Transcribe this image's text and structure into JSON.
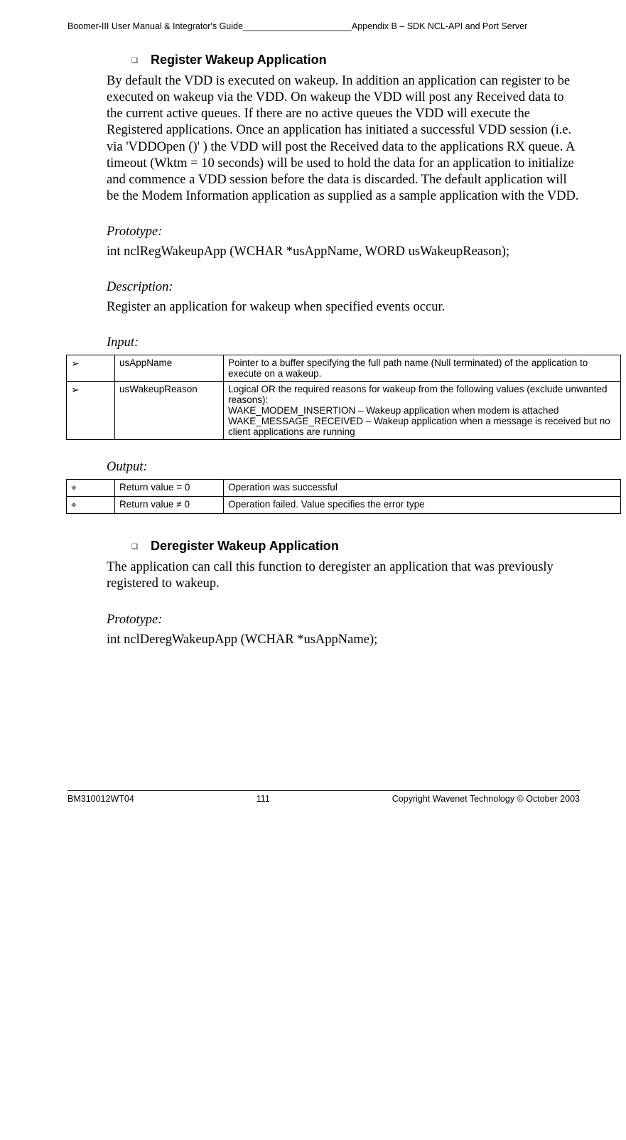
{
  "header": {
    "left": "Boomer-III User Manual & Integrator's Guide______________________Appendix B – SDK NCL-API and Port Server"
  },
  "section1": {
    "heading": "Register Wakeup Application",
    "body": "By default the VDD is executed on wakeup. In addition an application can register to be executed on wakeup via the VDD. On wakeup the VDD will post any Received data to the current active queues. If there are no active queues the VDD will execute the Registered applications. Once an application has initiated a successful VDD session (i.e. via 'VDDOpen ()' ) the VDD will post the Received data to the applications RX queue. A timeout (Wktm = 10 seconds) will be used to hold the data for an application to initialize and commence a VDD session before the data is discarded. The default application will be the Modem Information application as supplied as a sample application with the VDD.",
    "labels": {
      "prototype": "Prototype:",
      "description": "Description:",
      "input": "Input:",
      "output": "Output:"
    },
    "prototype_text": "int nclRegWakeupApp (WCHAR *usAppName, WORD usWakeupReason);",
    "description_text": "Register an application for wakeup when specified events occur.",
    "input_rows": [
      {
        "arrow": "➢",
        "name": "usAppName",
        "desc": "Pointer to a buffer specifying the full path name (Null terminated) of the application to execute on a wakeup."
      },
      {
        "arrow": "➢",
        "name": "usWakeupReason",
        "desc": "Logical OR the required reasons for wakeup from the following values (exclude unwanted reasons):\nWAKE_MODEM_INSERTION – Wakeup application when modem is attached\nWAKE_MESSAGE_RECEIVED – Wakeup application when a message is received but no client applications are running"
      }
    ],
    "output_rows": [
      {
        "arrow": "⌖",
        "name": "Return value = 0",
        "desc": "Operation was successful"
      },
      {
        "arrow": "⌖",
        "name": "Return value  ≠ 0",
        "desc": "Operation failed. Value specifies the error type"
      }
    ]
  },
  "section2": {
    "heading": "Deregister Wakeup Application",
    "body": "The application can call this function to deregister an application that was previously registered to wakeup.",
    "labels": {
      "prototype": "Prototype:"
    },
    "prototype_text": "int nclDeregWakeupApp (WCHAR *usAppName);"
  },
  "footer": {
    "left": "BM310012WT04",
    "center": "111",
    "right": "Copyright Wavenet Technology © October 2003"
  }
}
